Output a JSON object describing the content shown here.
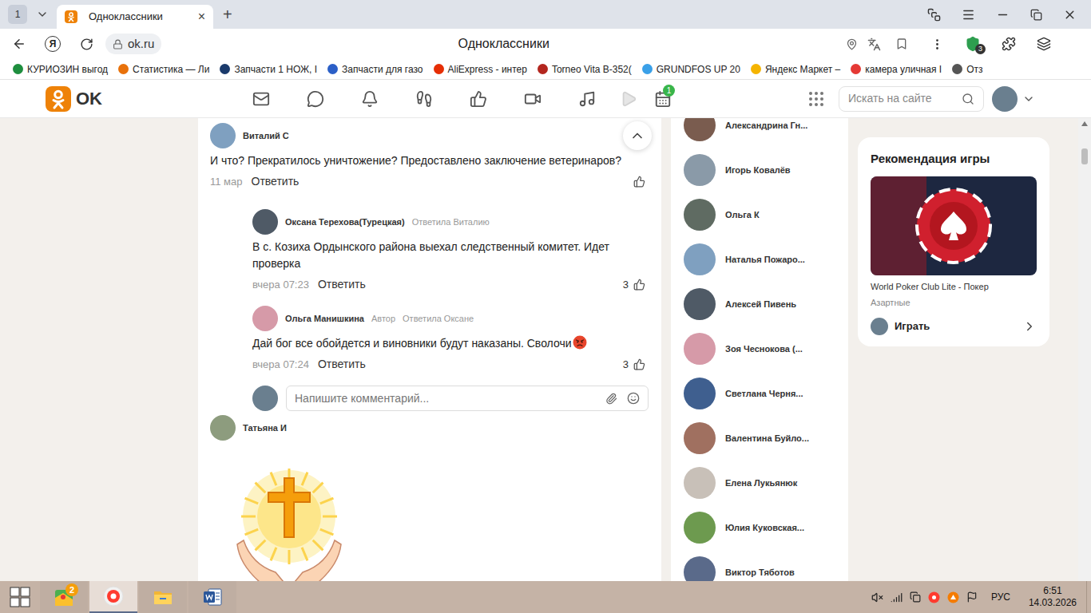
{
  "browser": {
    "tab_counter": "1",
    "tabs": [
      {
        "title": "Одноклассники",
        "selected": true
      }
    ],
    "close_tab": "×",
    "new_tab": "+",
    "yandex_logo": "Я",
    "address": "ok.ru",
    "page_title": "Одноклассники",
    "protect_badge": "3",
    "bookmarks": [
      {
        "label": "КУРИОЗИН выгод",
        "color": "#1e8e3e"
      },
      {
        "label": "Статистика — Ли",
        "color": "#e8710a"
      },
      {
        "label": "Запчасти 1 НОЖ, I",
        "color": "#1a3a6b"
      },
      {
        "label": "Запчасти для газо",
        "color": "#2b5fc7"
      },
      {
        "label": "AliExpress - интер",
        "color": "#e62e04"
      },
      {
        "label": "Torneo Vita B-352(",
        "color": "#b3261e"
      },
      {
        "label": "GRUNDFOS UP 20",
        "color": "#3aa0e8"
      },
      {
        "label": "Яндекс Маркет –",
        "color": "#f5b400"
      },
      {
        "label": "камера уличная I",
        "color": "#e53935"
      },
      {
        "label": "Отз",
        "color": "#555555"
      }
    ]
  },
  "site": {
    "logo": "OK",
    "nav": [
      {
        "badge": "",
        "dimmed": false
      },
      {
        "badge": "",
        "dimmed": false
      },
      {
        "badge": "",
        "dimmed": false
      },
      {
        "badge": "",
        "dimmed": false
      },
      {
        "badge": "",
        "dimmed": false
      },
      {
        "badge": "",
        "dimmed": false
      },
      {
        "badge": "",
        "dimmed": false
      },
      {
        "badge": "",
        "dimmed": true
      },
      {
        "badge": "1",
        "dimmed": false
      }
    ],
    "search_placeholder": "Искать на сайте"
  },
  "comments": [
    {
      "author": "Виталий С",
      "author_badge": "",
      "reply_to": "",
      "text": "И что? Прекратилось уничтожение? Предоставлено заключение ветеринаров?",
      "has_emoji": false,
      "time": "11 мар",
      "reply": "Ответить",
      "likes": "",
      "level": 0
    },
    {
      "author": "Оксана Терехова(Турецкая)",
      "author_badge": "",
      "reply_to": "Ответила Виталию",
      "text": "В с. Козиха Ордынского района выехал следственный комитет. Идет проверка",
      "has_emoji": false,
      "time": "вчера 07:23",
      "reply": "Ответить",
      "likes": "3",
      "level": 1
    },
    {
      "author": "Ольга Манишкина",
      "author_badge": "Автор",
      "reply_to": "Ответила Оксане",
      "text": "Дай бог все обойдется и виновники будут наказаны. Сволочи",
      "has_emoji": true,
      "time": "вчера 07:24",
      "reply": "Ответить",
      "likes": "3",
      "level": 1
    }
  ],
  "reply_form": {
    "placeholder": "Напишите комментарий..."
  },
  "next_comment": {
    "author": "Татьяна И"
  },
  "friends": [
    "Александрина Гн...",
    "Игорь Ковалёв",
    "Ольга К",
    "Наталья Пожаро...",
    "Алексей Пивень",
    "Зоя Чеснокова (...",
    "Светлана Черня...",
    "Валентина Буйло...",
    "Елена Лукьянюк",
    "Юлия Куковская...",
    "Виктор Тяботов"
  ],
  "recommendation": {
    "title": "Рекомендация игры",
    "game": "World Poker Club Lite - Покер",
    "category": "Азартные",
    "action": "Играть"
  },
  "taskbar": {
    "apps": [
      {
        "badge": "2",
        "selected": false
      },
      {
        "badge": "",
        "selected": true
      },
      {
        "badge": "",
        "selected": false
      },
      {
        "badge": "",
        "selected": false
      }
    ],
    "language": "РУС",
    "time": "6:51",
    "date": "14.03.2026"
  }
}
